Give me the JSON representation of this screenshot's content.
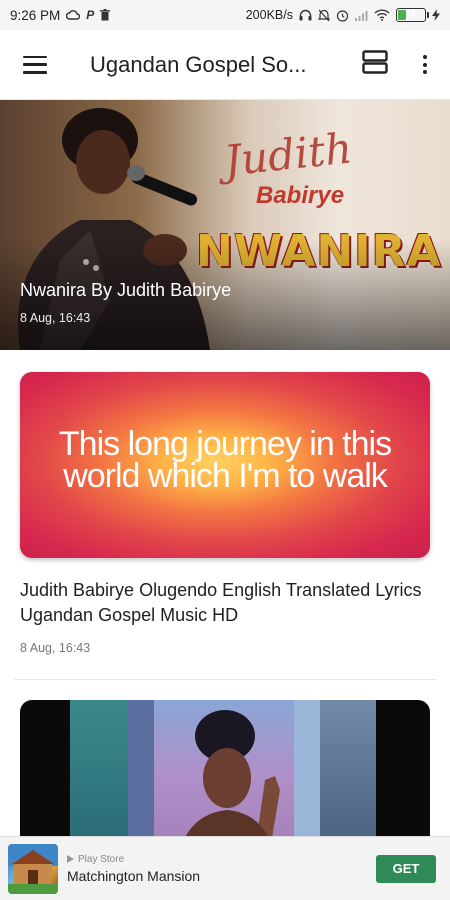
{
  "status_bar": {
    "time": "9:26 PM",
    "net_speed": "200KB/s",
    "battery": "31",
    "battery_level": 0.31,
    "icons": [
      "cloud-icon",
      "paypal-icon",
      "trash-icon",
      "headphones-icon",
      "mute-icon",
      "alarm-icon",
      "signal-icon",
      "wifi-icon",
      "battery-icon",
      "charging-icon"
    ]
  },
  "app_bar": {
    "title": "Ugandan Gospel So...",
    "menu_icon": "hamburger-menu-icon",
    "view_icon": "view-toggle-icon",
    "more_icon": "more-vert-icon"
  },
  "hero": {
    "artist_script": "Judith",
    "artist_surname": "Babirye",
    "song_art": "NWANIRA",
    "title": "Nwanira By Judith Babirye",
    "date": "8 Aug, 16:43"
  },
  "posts": [
    {
      "lyric_line_1": "This long journey in this",
      "lyric_line_2": "world which I'm to walk",
      "title": "Judith Babirye Olugendo English Translated Lyrics Ugandan Gospel Music HD",
      "date": "8 Aug, 16:43"
    }
  ],
  "ad": {
    "store": "Play Store",
    "name": "Matchington Mansion",
    "cta": "GET"
  },
  "colors": {
    "accent": "#2e8b57",
    "text_primary": "#212121",
    "text_secondary": "#777777"
  }
}
